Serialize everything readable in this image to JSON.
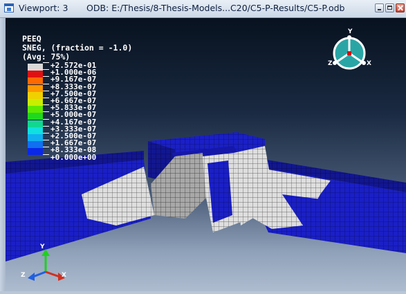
{
  "window": {
    "viewport_label": "Viewport: 3",
    "odb_label": "ODB: E:/Thesis/8-Thesis-Models...C20/C5-P-Results/C5-P.odb"
  },
  "legend": {
    "title_lines": [
      "PEEQ",
      "SNEG, (fraction = -1.0)",
      "(Avg: 75%)"
    ],
    "values": [
      "+2.572e-01",
      "+1.000e-06",
      "+9.167e-07",
      "+8.333e-07",
      "+7.500e-07",
      "+6.667e-07",
      "+5.833e-07",
      "+5.000e-07",
      "+4.167e-07",
      "+3.333e-07",
      "+2.500e-07",
      "+1.667e-07",
      "+8.333e-08",
      "+0.000e+00"
    ],
    "colors": [
      "#d9d9d9",
      "#e01010",
      "#ff6a00",
      "#ff9900",
      "#f0d000",
      "#c8ef00",
      "#5fe800",
      "#20d820",
      "#10d890",
      "#10e0e0",
      "#10b0f0",
      "#1070f0",
      "#0a28e8"
    ]
  },
  "view_triad": {
    "x": "X",
    "y": "Y",
    "z": "Z"
  },
  "global_triad": {
    "x": "X",
    "y": "Y",
    "z": "Z"
  },
  "icons": {
    "title": "viewport-window-icon",
    "minimize": "minimize-icon",
    "maximize": "maximize-icon",
    "close": "close-icon"
  },
  "colors": {
    "mesh_blue": "#1a1fc6",
    "yielded_white": "#dcdcdc",
    "background_top": "#08121f",
    "background_bottom": "#aebccf"
  }
}
